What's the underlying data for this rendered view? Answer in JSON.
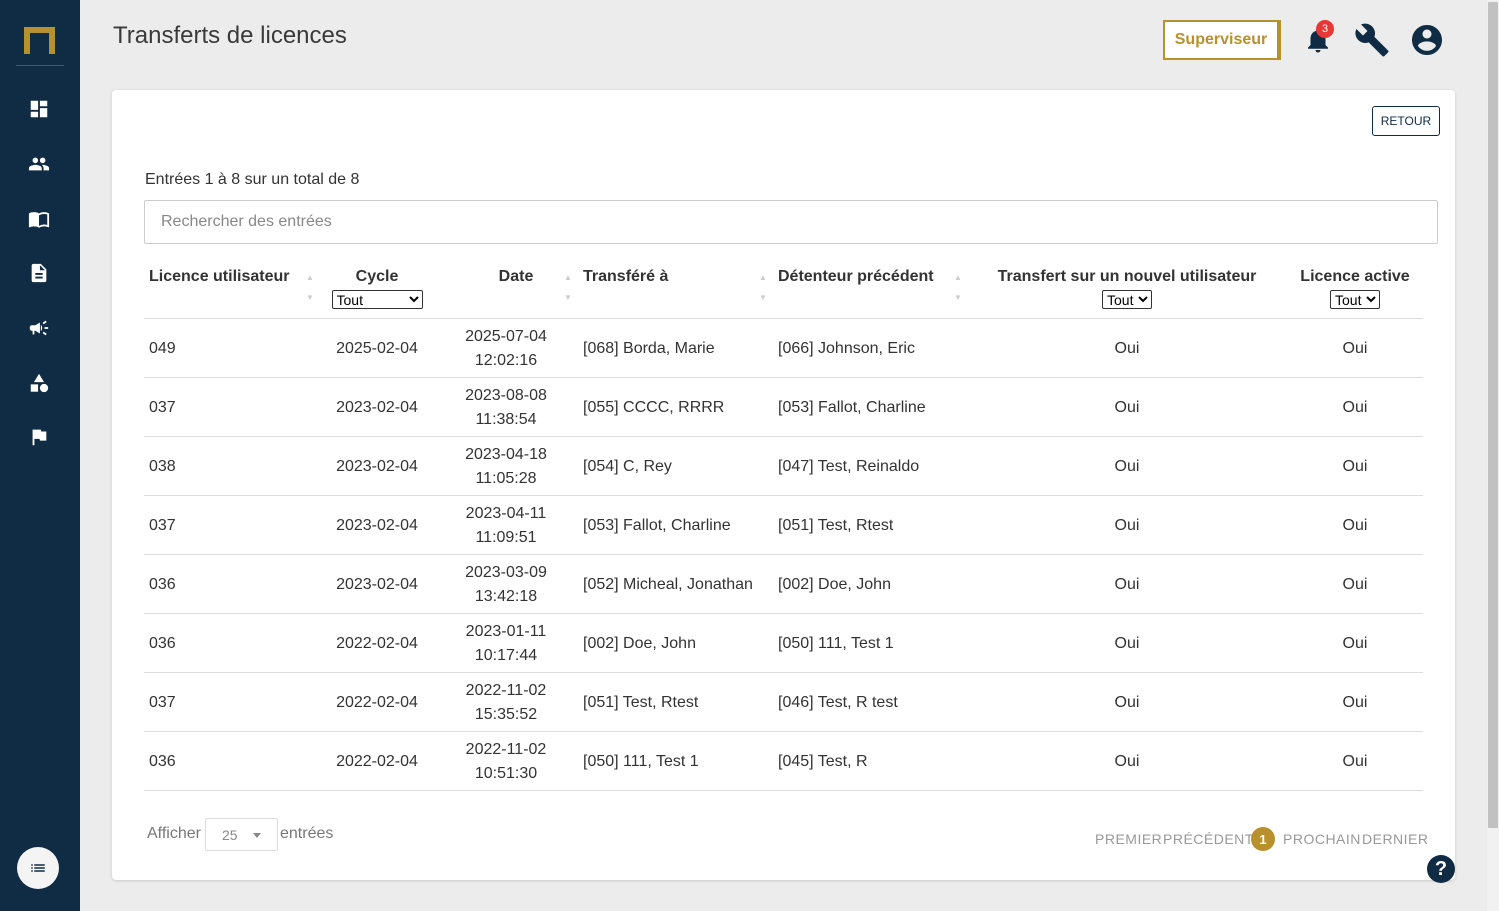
{
  "page": {
    "title": "Transferts de licences"
  },
  "header": {
    "supervisor_label": "Superviseur",
    "notification_count": "3"
  },
  "colors": {
    "sidebar": "#0f2c44",
    "accent": "#b8902e",
    "badge": "#e53935"
  },
  "sidebar": {
    "items": [
      {
        "icon": "dashboard-icon"
      },
      {
        "icon": "users-icon"
      },
      {
        "icon": "book-icon"
      },
      {
        "icon": "document-icon"
      },
      {
        "icon": "megaphone-icon"
      },
      {
        "icon": "shapes-icon"
      },
      {
        "icon": "flag-icon"
      }
    ]
  },
  "card": {
    "back_label": "RETOUR",
    "entries_info": "Entrées 1 à 8 sur un total de 8",
    "search_placeholder": "Rechercher des entrées"
  },
  "table": {
    "columns": {
      "licence": "Licence utilisateur",
      "cycle": "Cycle",
      "date": "Date",
      "transferred_to": "Transféré à",
      "previous_holder": "Détenteur précédent",
      "new_user": "Transfert sur un nouvel utilisateur",
      "active": "Licence active"
    },
    "filters": {
      "cycle": "Tout",
      "new_user": "Tout",
      "active": "Tout"
    },
    "rows": [
      {
        "licence": "049",
        "cycle": "2025-02-04",
        "date": "2025-07-04",
        "time": "12:02:16",
        "to": "[068] Borda, Marie",
        "from": "[066] Johnson, Eric",
        "new_user": "Oui",
        "active": "Oui"
      },
      {
        "licence": "037",
        "cycle": "2023-02-04",
        "date": "2023-08-08",
        "time": "11:38:54",
        "to": "[055] CCCC, RRRR",
        "from": "[053] Fallot, Charline",
        "new_user": "Oui",
        "active": "Oui"
      },
      {
        "licence": "038",
        "cycle": "2023-02-04",
        "date": "2023-04-18",
        "time": "11:05:28",
        "to": "[054] C, Rey",
        "from": "[047] Test, Reinaldo",
        "new_user": "Oui",
        "active": "Oui"
      },
      {
        "licence": "037",
        "cycle": "2023-02-04",
        "date": "2023-04-11",
        "time": "11:09:51",
        "to": "[053] Fallot, Charline",
        "from": "[051] Test, Rtest",
        "new_user": "Oui",
        "active": "Oui"
      },
      {
        "licence": "036",
        "cycle": "2023-02-04",
        "date": "2023-03-09",
        "time": "13:42:18",
        "to": "[052] Micheal, Jonathan",
        "from": "[002] Doe, John",
        "new_user": "Oui",
        "active": "Oui"
      },
      {
        "licence": "036",
        "cycle": "2022-02-04",
        "date": "2023-01-11",
        "time": "10:17:44",
        "to": "[002] Doe, John",
        "from": "[050] 111, Test 1",
        "new_user": "Oui",
        "active": "Oui"
      },
      {
        "licence": "037",
        "cycle": "2022-02-04",
        "date": "2022-11-02",
        "time": "15:35:52",
        "to": "[051] Test, Rtest",
        "from": "[046] Test, R test",
        "new_user": "Oui",
        "active": "Oui"
      },
      {
        "licence": "036",
        "cycle": "2022-02-04",
        "date": "2022-11-02",
        "time": "10:51:30",
        "to": "[050] 111, Test 1",
        "from": "[045] Test, R",
        "new_user": "Oui",
        "active": "Oui"
      }
    ]
  },
  "footer": {
    "show_label": "Afficher",
    "page_size": "25",
    "show_suffix": "entrées",
    "first": "PREMIER",
    "previous": "PRÉCÉDENT",
    "current_page": "1",
    "next": "PROCHAIN",
    "last": "DERNIER"
  },
  "help": {
    "label": "?"
  }
}
